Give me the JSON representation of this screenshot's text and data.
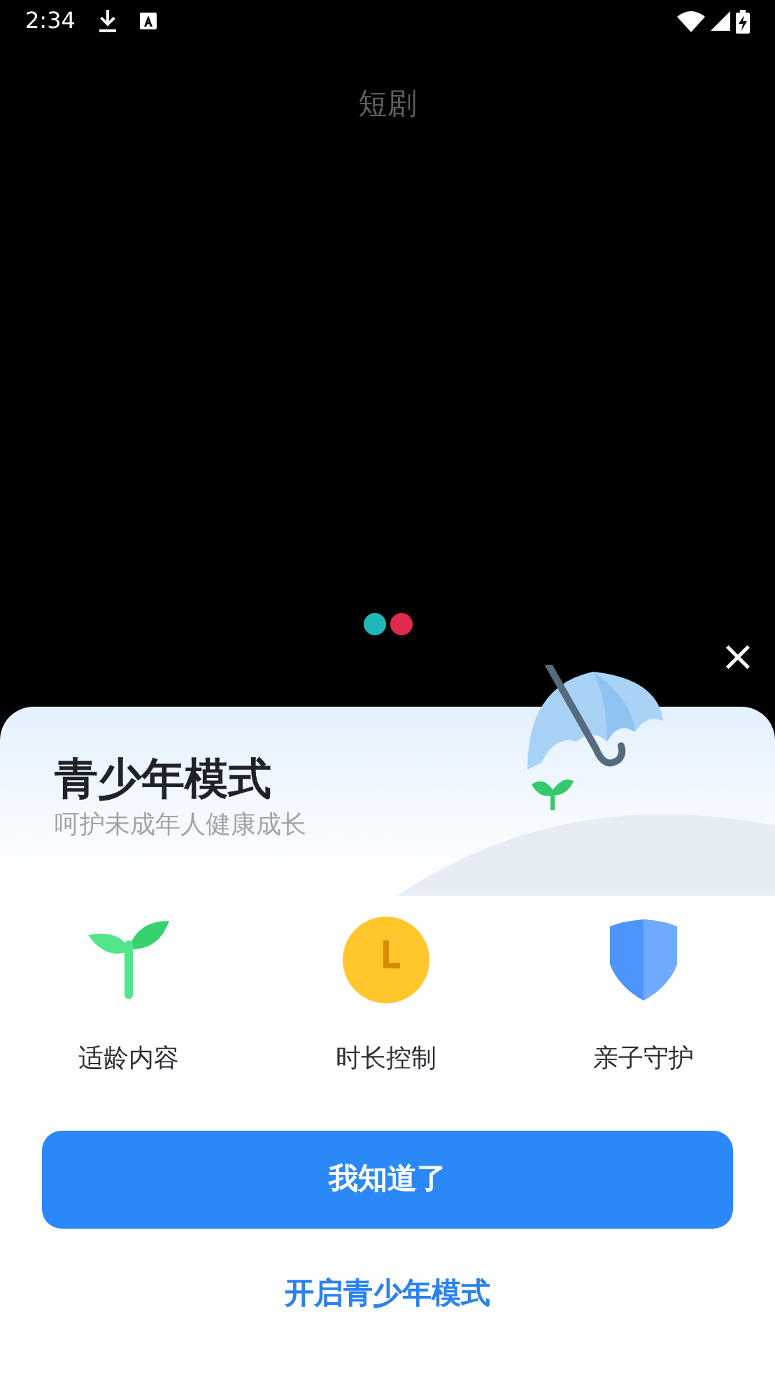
{
  "status_bar": {
    "time": "2:34"
  },
  "header": {
    "title": "短剧"
  },
  "loading_dots": [
    {
      "color": "#1fb8b8"
    },
    {
      "color": "#e0294f"
    }
  ],
  "dialog": {
    "close": "×",
    "title": "青少年模式",
    "subtitle": "呵护未成年人健康成长",
    "features": [
      {
        "kind": "sprout",
        "label": "适龄内容"
      },
      {
        "kind": "clock",
        "label": "时长控制"
      },
      {
        "kind": "shield",
        "label": "亲子守护"
      }
    ],
    "primary_button": "我知道了",
    "link": "开启青少年模式"
  }
}
